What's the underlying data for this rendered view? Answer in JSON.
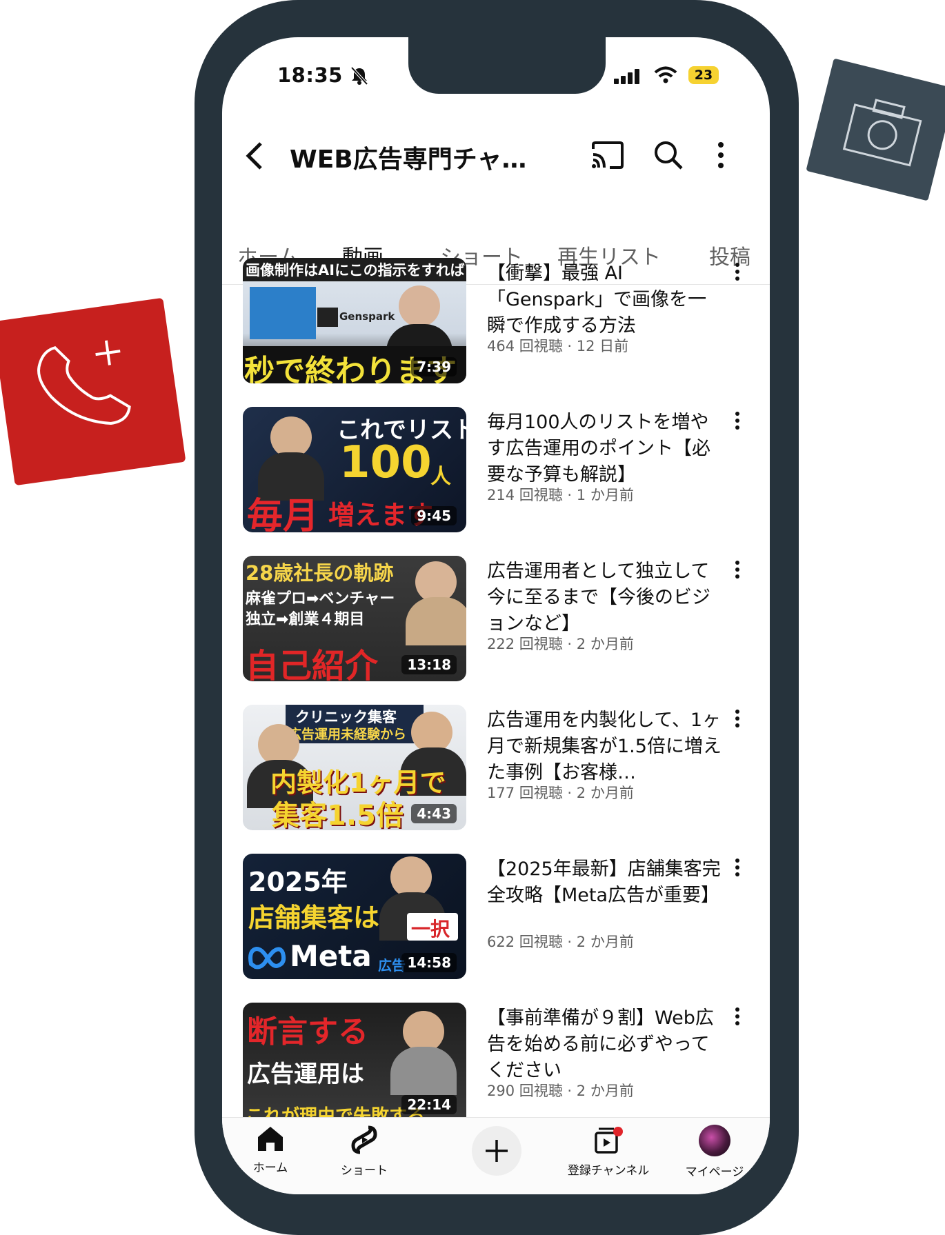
{
  "status_bar": {
    "time": "18:35",
    "battery": "23"
  },
  "app_bar": {
    "title": "WEB広告専門チャ…"
  },
  "tabs": [
    {
      "label": "ホーム"
    },
    {
      "label": "動画"
    },
    {
      "label": "ショート"
    },
    {
      "label": "再生リスト"
    },
    {
      "label": "投稿"
    }
  ],
  "videos": [
    {
      "title": "【衝撃】最強 AI「Genspark」で画像を一瞬で作成する方法",
      "meta": "464 回視聴 · 12 日前",
      "duration": "7:39",
      "thumb_top": "画像制作はAIにこの指示をすれば",
      "thumb_main": "秒で終わります",
      "thumb_sub": "Genspark"
    },
    {
      "title": "毎月100人のリストを増やす広告運用のポイント【必要な予算も解説】",
      "meta": "214 回視聴 · 1 か月前",
      "duration": "9:45",
      "thumb_top": "これでリスト",
      "thumb_num": "100",
      "thumb_unit": "人",
      "thumb_main": "毎月",
      "thumb_sub": "増えます"
    },
    {
      "title": "広告運用者として独立して今に至るまで【今後のビジョンなど】",
      "meta": "222 回視聴 · 2 か月前",
      "duration": "13:18",
      "thumb_top": "28歳社長の軌跡",
      "thumb_l2": "麻雀プロ➡ベンチャー",
      "thumb_l3": "独立➡創業４期目",
      "thumb_main": "自己紹介"
    },
    {
      "title": "広告運用を内製化して、1ヶ月で新規集客が1.5倍に増えた事例【お客様…",
      "meta": "177 回視聴 · 2 か月前",
      "duration": "4:43",
      "thumb_top": "クリニック集客",
      "thumb_l2": "広告運用未経験から",
      "thumb_main": "内製化1ヶ月で",
      "thumb_sub": "集客1.5倍"
    },
    {
      "title": "【2025年最新】店舗集客完全攻略【Meta広告が重要】",
      "meta": "622 回視聴 · 2 か月前",
      "duration": "14:58",
      "thumb_top": "2025年",
      "thumb_main": "店舗集客は",
      "thumb_badge": "一択",
      "thumb_sub": "Meta",
      "thumb_small": "広告"
    },
    {
      "title": "【事前準備が９割】Web広告を始める前に必ずやってください",
      "meta": "290 回視聴 · 2 か月前",
      "duration": "22:14",
      "thumb_top": "断言する",
      "thumb_main": "広告運用は",
      "thumb_sub": "これが理由で失敗する"
    }
  ],
  "bottom_nav": [
    {
      "label": "ホーム",
      "icon": "home-icon"
    },
    {
      "label": "ショート",
      "icon": "shorts-icon"
    },
    {
      "label": "",
      "icon": "create-icon"
    },
    {
      "label": "登録チャンネル",
      "icon": "subscriptions-icon"
    },
    {
      "label": "マイページ",
      "icon": "avatar"
    }
  ],
  "colors": {
    "accent": "#c7201e",
    "frame": "#26333c",
    "battery": "#f6d231"
  }
}
